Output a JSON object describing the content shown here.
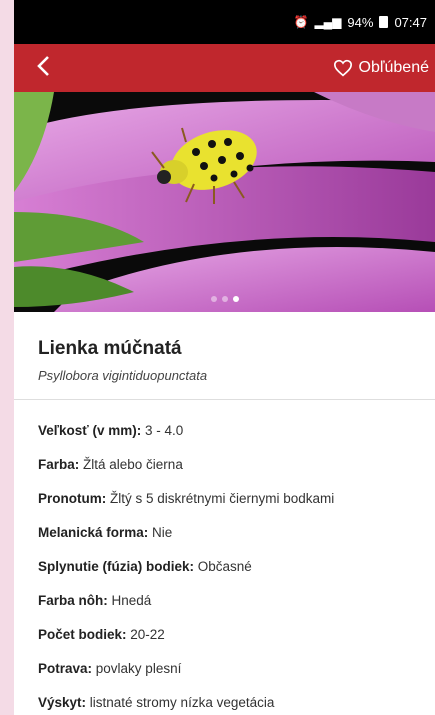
{
  "status_bar": {
    "battery_percent": "94%",
    "time": "07:47"
  },
  "app_bar": {
    "favorite_label": "Obľúbené"
  },
  "carousel": {
    "dot_count": 3,
    "active_index": 2
  },
  "species": {
    "name": "Lienka múčnatá",
    "latin": "Psyllobora vigintiduopunctata"
  },
  "details": [
    {
      "label": "Veľkosť (v mm):",
      "value": " 3 - 4.0"
    },
    {
      "label": "Farba:",
      "value": " Žltá alebo čierna"
    },
    {
      "label": "Pronotum:",
      "value": " Žltý s 5 diskrétnymi čiernymi bodkami"
    },
    {
      "label": "Melanická forma:",
      "value": " Nie"
    },
    {
      "label": "Splynutie (fúzia) bodiek:",
      "value": " Občasné"
    },
    {
      "label": "Farba nôh:",
      "value": " Hnedá"
    },
    {
      "label": "Počet bodiek:",
      "value": " 20-22"
    },
    {
      "label": "Potrava:",
      "value": " povlaky plesní"
    },
    {
      "label": "Výskyt:",
      "value": " listnaté stromy nízka vegetácia"
    }
  ],
  "colors": {
    "accent": "#c0272d",
    "background": "#f4dbe6"
  }
}
